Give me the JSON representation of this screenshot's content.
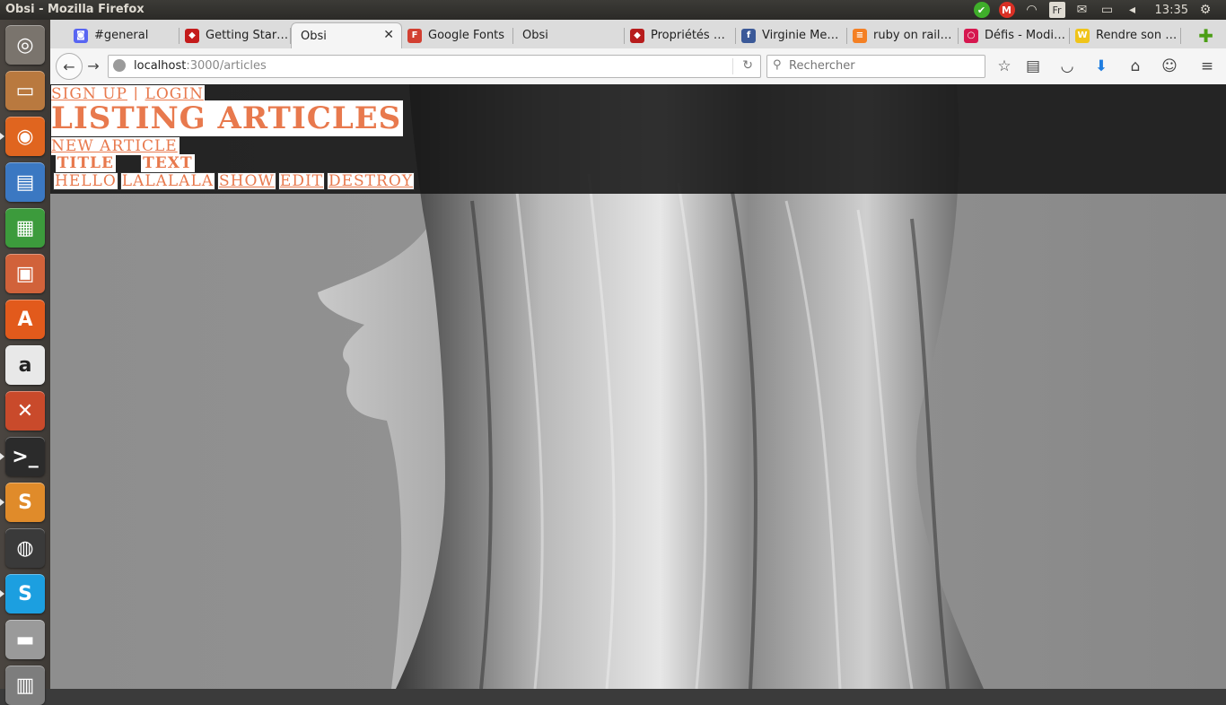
{
  "system": {
    "window_title": "Obsi - Mozilla Firefox",
    "keyboard": "Fr",
    "clock": "13:35"
  },
  "launcher": {
    "items": [
      {
        "name": "ubuntu-dash-icon",
        "glyph": "◎",
        "color": "#7a746d"
      },
      {
        "name": "files-icon",
        "glyph": "▭",
        "color": "#b9793f"
      },
      {
        "name": "firefox-icon",
        "glyph": "◉",
        "color": "#e0651f"
      },
      {
        "name": "writer-icon",
        "glyph": "▤",
        "color": "#3b78c2"
      },
      {
        "name": "calc-icon",
        "glyph": "▦",
        "color": "#3c9b3c"
      },
      {
        "name": "impress-icon",
        "glyph": "▣",
        "color": "#d1623a"
      },
      {
        "name": "software-center-icon",
        "glyph": "A",
        "color": "#e25a1c"
      },
      {
        "name": "amazon-icon",
        "glyph": "a",
        "color": "#e8e8e8"
      },
      {
        "name": "system-settings-icon",
        "glyph": "✕",
        "color": "#c94a2b"
      },
      {
        "name": "terminal-icon",
        "glyph": ">_",
        "color": "#2b2b2b"
      },
      {
        "name": "sublime-text-icon",
        "glyph": "S",
        "color": "#e08b2a"
      },
      {
        "name": "disk-icon",
        "glyph": "◍",
        "color": "#3a3a3a"
      },
      {
        "name": "skype-icon",
        "glyph": "S",
        "color": "#1c9fe0"
      },
      {
        "name": "scanner-icon",
        "glyph": "▬",
        "color": "#9a9a9a"
      },
      {
        "name": "trash-icon",
        "glyph": "▥",
        "color": "#7d7d7d"
      }
    ]
  },
  "tabs": [
    {
      "label": "#general",
      "fav": "#5865f2",
      "fav_glyph": "◙"
    },
    {
      "label": "Getting Star…",
      "fav": "#c41b1b",
      "fav_glyph": "◆"
    },
    {
      "label": "Obsi",
      "fav": "",
      "fav_glyph": "",
      "active": true
    },
    {
      "label": "Google Fonts",
      "fav": "#d23f31",
      "fav_glyph": "F"
    },
    {
      "label": "Obsi",
      "fav": "",
      "fav_glyph": ""
    },
    {
      "label": "Propriétés …",
      "fav": "#b71c1c",
      "fav_glyph": "◆"
    },
    {
      "label": "Virginie Me…",
      "fav": "#3b5998",
      "fav_glyph": "f"
    },
    {
      "label": "ruby on rail…",
      "fav": "#f48024",
      "fav_glyph": "≡"
    },
    {
      "label": "Défis - Modi…",
      "fav": "#d6174f",
      "fav_glyph": "○"
    },
    {
      "label": "Rendre son …",
      "fav": "#f0c419",
      "fav_glyph": "W"
    }
  ],
  "navbar": {
    "url_host": "localhost",
    "url_path": ":3000/articles",
    "search_placeholder": "Rechercher"
  },
  "page": {
    "sign_up": "Sign up",
    "separator": "|",
    "login": "Login",
    "title": "Listing Articles",
    "new_article": "New article",
    "table": {
      "headers": [
        "Title",
        "Text"
      ],
      "rows": [
        {
          "title": "hello",
          "text": "lalalala",
          "show": "Show",
          "edit": "Edit",
          "destroy": "Destroy"
        }
      ]
    }
  }
}
